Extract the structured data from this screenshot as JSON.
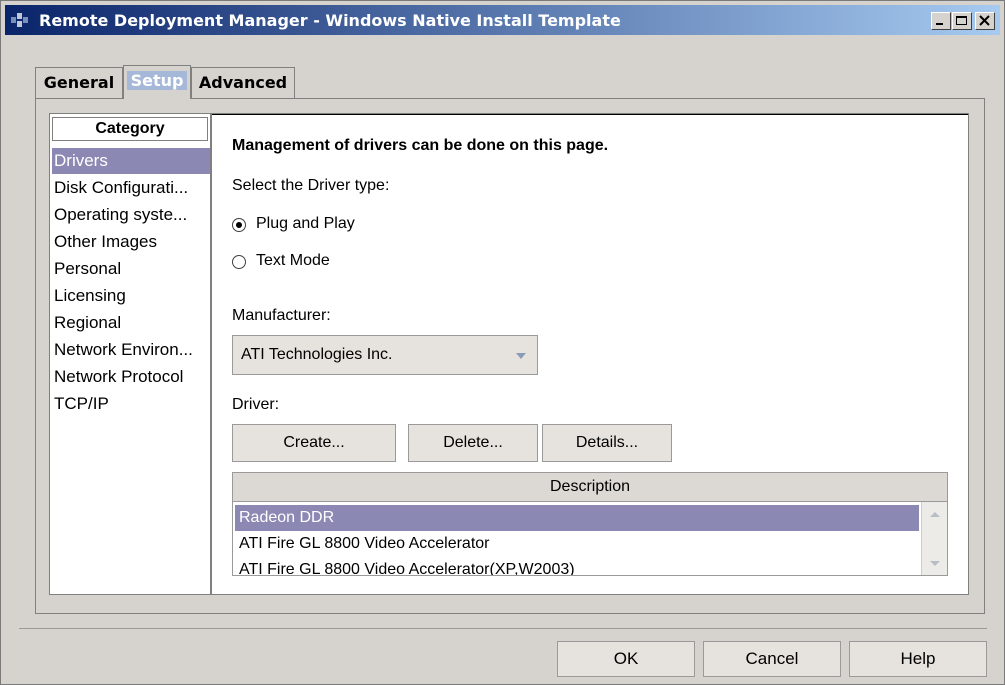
{
  "window": {
    "title": "Remote Deployment Manager - Windows Native Install Template",
    "controls": [
      "minimize-icon",
      "maximize-icon",
      "close-icon"
    ]
  },
  "tabs": [
    {
      "label": "General",
      "active": false
    },
    {
      "label": "Setup",
      "active": true
    },
    {
      "label": "Advanced",
      "active": false
    }
  ],
  "category": {
    "header": "Category",
    "items": [
      {
        "label": "Drivers",
        "selected": true
      },
      {
        "label": "Disk Configurati...",
        "selected": false
      },
      {
        "label": "Operating syste...",
        "selected": false
      },
      {
        "label": "Other Images",
        "selected": false
      },
      {
        "label": "Personal",
        "selected": false
      },
      {
        "label": "Licensing",
        "selected": false
      },
      {
        "label": "Regional",
        "selected": false
      },
      {
        "label": "Network Environ...",
        "selected": false
      },
      {
        "label": "Network Protocol",
        "selected": false
      },
      {
        "label": "TCP/IP",
        "selected": false
      }
    ]
  },
  "drivers": {
    "heading": "Management of drivers can be done on this page.",
    "driver_type_label": "Select the Driver type:",
    "radio_pnp": {
      "label": "Plug and Play",
      "checked": true
    },
    "radio_text": {
      "label": "Text Mode",
      "checked": false
    },
    "manufacturer_label": "Manufacturer:",
    "manufacturer_value": "ATI Technologies Inc.",
    "driver_label": "Driver:",
    "buttons": {
      "create": "Create...",
      "delete": "Delete...",
      "details": "Details..."
    },
    "description_header": "Description",
    "descriptions": [
      {
        "label": "Radeon DDR",
        "selected": true
      },
      {
        "label": "ATI Fire GL 8800 Video Accelerator",
        "selected": false
      },
      {
        "label": "ATI Fire GL 8800 Video Accelerator(XP,W2003)",
        "selected": false
      }
    ]
  },
  "footer": {
    "ok": "OK",
    "cancel": "Cancel",
    "help": "Help"
  },
  "colors": {
    "selection": "#8b88b3",
    "face": "#d6d3ce",
    "title_start": "#0a246a"
  }
}
